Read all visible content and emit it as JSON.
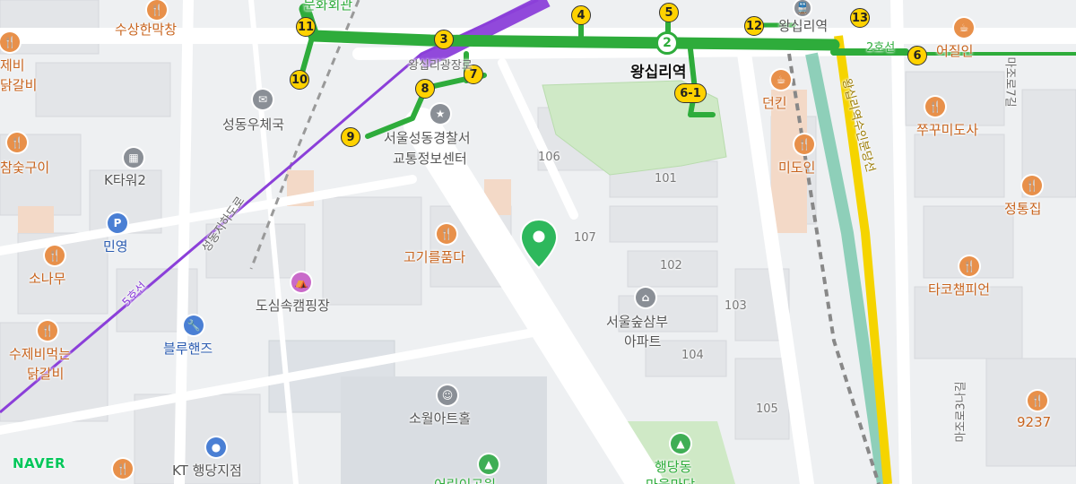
{
  "map": {
    "brand": "NAVER",
    "station": {
      "name": "왕십리역",
      "line_badge": "2",
      "small_label": "왕십리역"
    },
    "lines": {
      "line2": {
        "label": "2호선",
        "color": "#2eac3b"
      },
      "line5": {
        "label": "5호선",
        "color": "#8b3fd9"
      },
      "bundang": {
        "color": "#f5d400"
      },
      "gyeongui": {
        "color": "#6dc4a6"
      }
    },
    "roads": {
      "wangsimni_gwangjangro": "왕십리광장로",
      "seongdong_underpass": "성동지하도로",
      "majoro7gil": "마조로7길",
      "majoro3nagil": "마조로3나길",
      "vertical_rail_label": "왕십리역수인분당선"
    },
    "exits": [
      "3",
      "4",
      "5",
      "6",
      "6-1",
      "7",
      "8",
      "9",
      "10",
      "11",
      "12",
      "13"
    ],
    "pois": {
      "sang_hanmakchang": "수상한막창",
      "jebi_dakgalbi_line1": "제비",
      "jebi_dakgalbi_line2": "닭갈비",
      "post_office": "성동우체국",
      "munhwa_hall": "문화회관",
      "charcoal": "참숯구이",
      "k_tower": "K타워2",
      "parking": "P",
      "minyoung": "민영",
      "sonamu": "소나무",
      "police_line1": "서울성동경찰서",
      "police_line2": "교통정보센터",
      "gogi_pumda": "고기를품다",
      "camping": "도심속캠핑장",
      "blue_hands": "블루핸즈",
      "dak_line1": "수제비먹는",
      "dak_line2": "닭갈비",
      "sowol_art_hall": "소월아트홀",
      "kt_branch": "KT 행당지점",
      "apt_line1": "서울숲삼부",
      "apt_line2": "아파트",
      "dunkin": "던킨",
      "midoin": "미도인",
      "eojilin": "어질인",
      "jjukkumi": "쭈꾸미도사",
      "jeongtongjip": "정통집",
      "taco": "타코챔피언",
      "n9237": "9237",
      "haengdang_line1": "행당동",
      "haengdang_line2": "마을마당",
      "bottom_park": "어린이공원"
    },
    "buildings": [
      "106",
      "101",
      "107",
      "102",
      "103",
      "104",
      "105"
    ]
  }
}
